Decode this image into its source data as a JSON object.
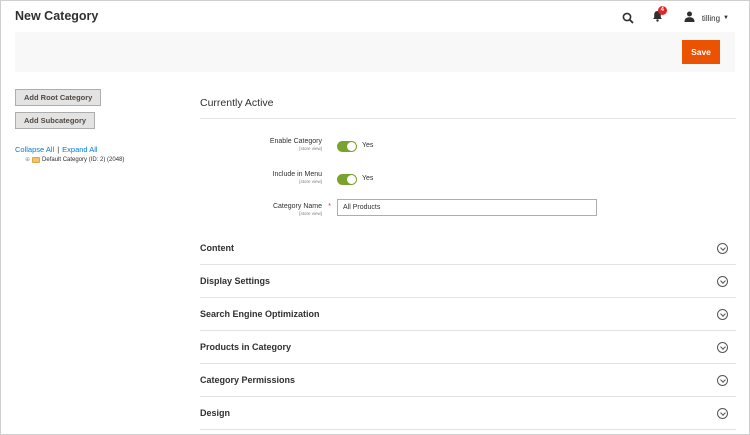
{
  "header": {
    "title": "New Category",
    "notification_count": "4",
    "username": "tilling"
  },
  "action_bar": {
    "save_label": "Save"
  },
  "sidebar": {
    "add_root_label": "Add Root Category",
    "add_sub_label": "Add Subcategory",
    "collapse_all": "Collapse All",
    "separator": "|",
    "expand_all": "Expand All",
    "tree_root": "Default Category (ID: 2) (2048)"
  },
  "main": {
    "section_title": "Currently Active",
    "fields": {
      "enable": {
        "label": "Enable Category",
        "scope": "[store view]",
        "value": "Yes"
      },
      "menu": {
        "label": "Include in Menu",
        "scope": "[store view]",
        "value": "Yes"
      },
      "name": {
        "label": "Category Name",
        "scope": "[store view]",
        "value": "All Products",
        "required": "*"
      }
    },
    "collapsibles": [
      {
        "title": "Content"
      },
      {
        "title": "Display Settings"
      },
      {
        "title": "Search Engine Optimization"
      },
      {
        "title": "Products in Category"
      },
      {
        "title": "Category Permissions"
      },
      {
        "title": "Design"
      }
    ]
  },
  "colors": {
    "accent": "#eb5202",
    "toggle_on": "#79a22e",
    "link": "#007bdb",
    "badge": "#e22626"
  }
}
